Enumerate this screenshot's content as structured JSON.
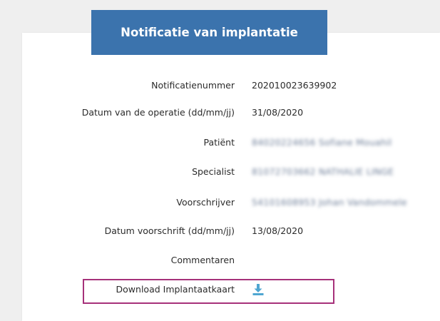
{
  "header": {
    "title": "Notificatie van implantatie"
  },
  "fields": [
    {
      "label": "Notificatienummer",
      "value": "202010023639902",
      "blurred": false
    },
    {
      "label": "Datum van de operatie (dd/mm/jj)",
      "value": "31/08/2020",
      "blurred": false
    },
    {
      "label": "Patiënt",
      "value": "84020224656  Sofiane Mouahil",
      "blurred": true
    },
    {
      "label": "Specialist",
      "value": "81072703662  NATHALIE LINGE",
      "blurred": true
    },
    {
      "label": "Voorschrijver",
      "value": "54101608953  Johan Vandommele",
      "blurred": true
    },
    {
      "label": "Datum voorschrift (dd/mm/jj)",
      "value": "13/08/2020",
      "blurred": false
    },
    {
      "label": "Commentaren",
      "value": "",
      "blurred": false
    }
  ],
  "download": {
    "label": "Download Implantaatkaart",
    "icon": "download-icon"
  },
  "colors": {
    "header_bg": "#3b73ad",
    "highlight_border": "#a6317a",
    "icon": "#4fa6d1"
  }
}
